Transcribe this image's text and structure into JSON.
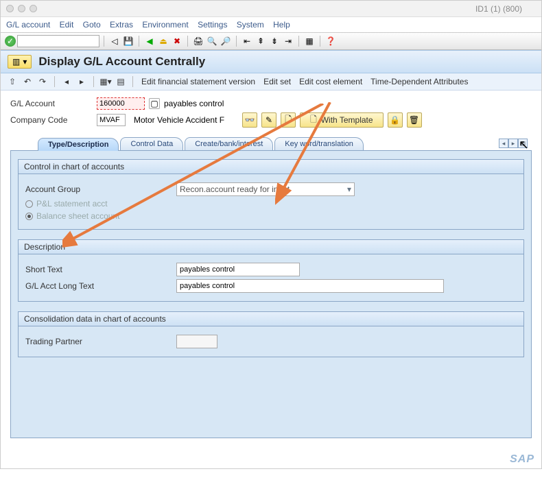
{
  "window": {
    "title": "ID1 (1) (800)"
  },
  "menubar": [
    "G/L account",
    "Edit",
    "Goto",
    "Extras",
    "Environment",
    "Settings",
    "System",
    "Help"
  ],
  "app": {
    "title": "Display G/L Account Centrally",
    "toolbar_links": [
      "Edit financial statement version",
      "Edit set",
      "Edit cost element",
      "Time-Dependent Attributes"
    ]
  },
  "header": {
    "gl_account_label": "G/L Account",
    "gl_account_value": "160000",
    "gl_account_text": "payables control",
    "company_code_label": "Company Code",
    "company_code_value": "MVAF",
    "company_code_text": "Motor Vehicle Accident F",
    "with_template_label": "With Template"
  },
  "tabs": [
    "Type/Description",
    "Control Data",
    "Create/bank/interest",
    "Key word/translation"
  ],
  "active_tab": "Type/Description",
  "panel_control": {
    "title": "Control in chart of accounts",
    "account_group_label": "Account Group",
    "account_group_value": "Recon.account ready for input",
    "radio_pnl": "P&L statement acct",
    "radio_balance": "Balance sheet account"
  },
  "panel_desc": {
    "title": "Description",
    "short_text_label": "Short Text",
    "short_text_value": "payables control",
    "long_text_label": "G/L Acct Long Text",
    "long_text_value": "payables control"
  },
  "panel_cons": {
    "title": "Consolidation data in chart of accounts",
    "trading_partner_label": "Trading Partner",
    "trading_partner_value": ""
  },
  "footer": {
    "logo": "SAP"
  }
}
